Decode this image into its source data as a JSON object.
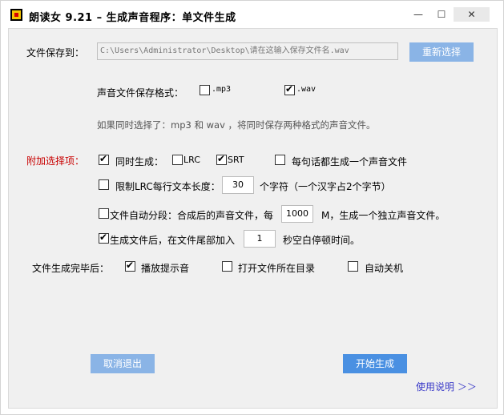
{
  "window": {
    "title": "朗读女 9.21 – 生成声音程序：单文件生成",
    "min_glyph": "—",
    "max_glyph": "☐",
    "close_glyph": "✕"
  },
  "save": {
    "label": "文件保存到：",
    "path_value": "C:\\Users\\Administrator\\Desktop\\请在这输入保存文件名.wav",
    "reselect_label": "重新选择"
  },
  "format": {
    "label": "声音文件保存格式：",
    "mp3": {
      "label": ".mp3",
      "checked": false
    },
    "wav": {
      "label": ".wav",
      "checked": true
    },
    "hint": "如果同时选择了：mp3 和 wav ，将同时保存两种格式的声音文件。"
  },
  "extra": {
    "section_label": "附加选择项：",
    "sync_gen": {
      "label": "同时生成：",
      "checked": true
    },
    "lrc": {
      "label": "LRC",
      "checked": false
    },
    "srt": {
      "label": "SRT",
      "checked": true
    },
    "per_sentence": {
      "label": "每句话都生成一个声音文件",
      "checked": false
    },
    "limit_lrc": {
      "label": "限制LRC每行文本长度：",
      "checked": false,
      "value": "30",
      "suffix": "个字符（一个汉字占2个字节）"
    },
    "auto_split": {
      "label": "文件自动分段：合成后的声音文件，每",
      "checked": false,
      "value": "1000",
      "suffix": "M，生成一个独立声音文件。"
    },
    "append_silence": {
      "label": "生成文件后，在文件尾部加入",
      "checked": true,
      "value": "1",
      "suffix": "秒空白停顿时间。"
    }
  },
  "after": {
    "label": "文件生成完毕后：",
    "play_sound": {
      "label": "播放提示音",
      "checked": true
    },
    "open_folder": {
      "label": "打开文件所在目录",
      "checked": false
    },
    "shutdown": {
      "label": "自动关机",
      "checked": false
    }
  },
  "actions": {
    "cancel_label": "取消退出",
    "start_label": "开始生成",
    "help_label": "使用说明 ＞＞"
  },
  "colors": {
    "accent": "#4a90e2",
    "accent_disabled": "#8ab4e6",
    "section_red": "#c80000",
    "link": "#3a3ac8"
  }
}
